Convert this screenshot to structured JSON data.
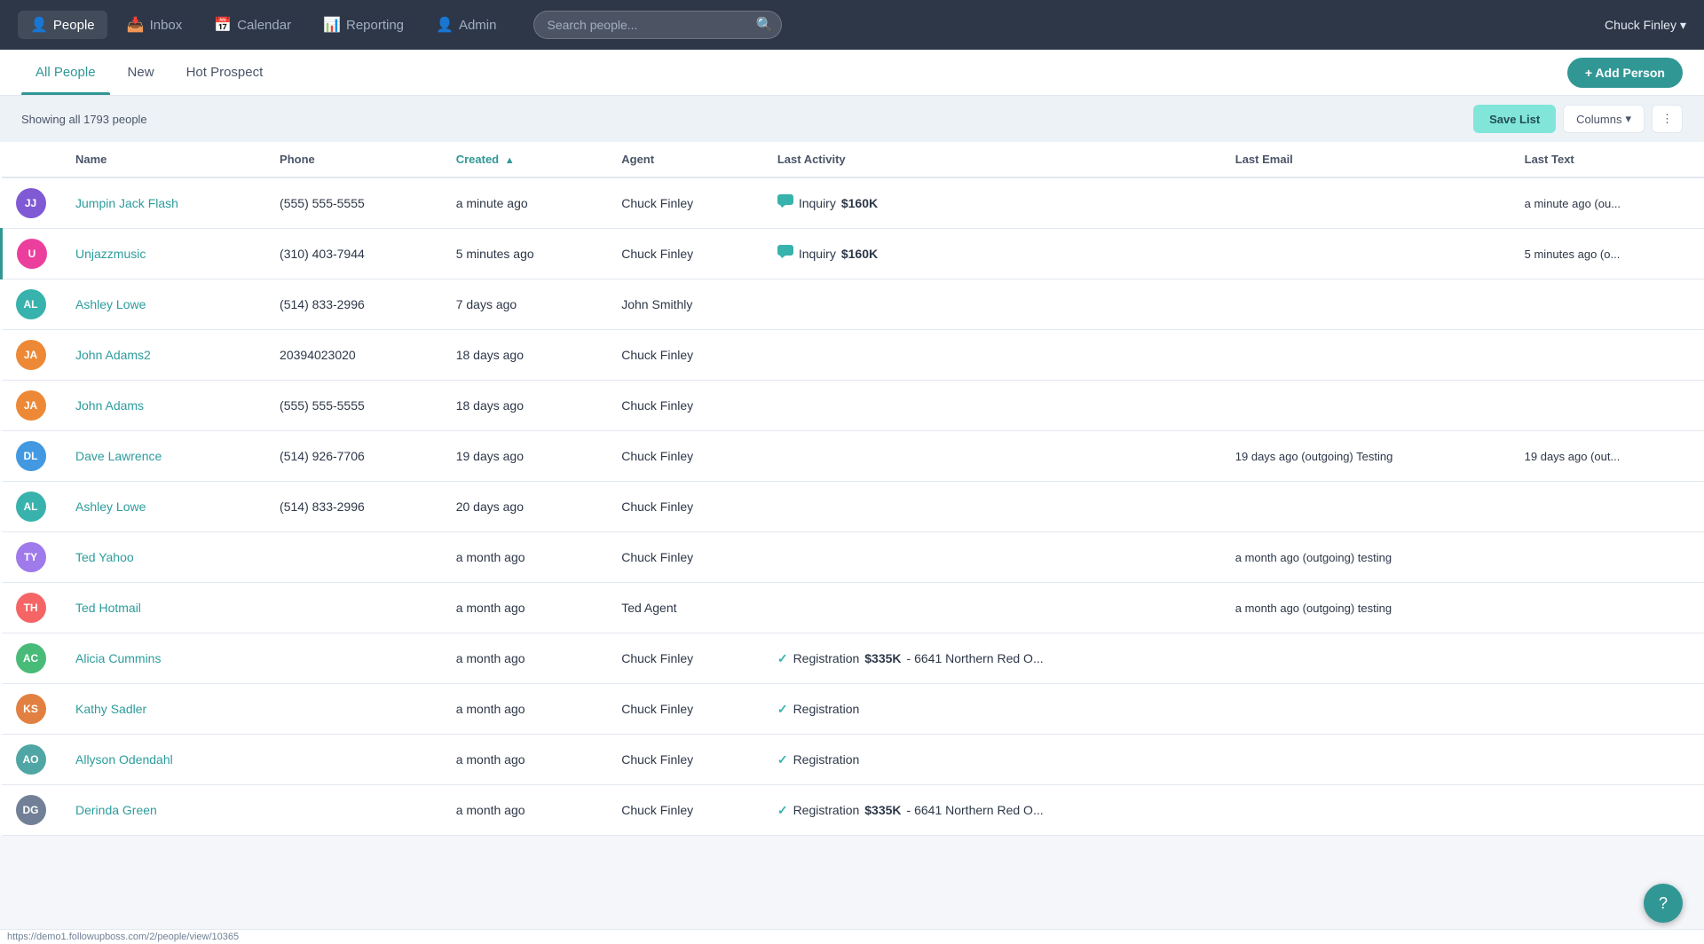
{
  "nav": {
    "brand": "People",
    "items": [
      {
        "id": "people",
        "label": "People",
        "icon": "👤",
        "active": true
      },
      {
        "id": "inbox",
        "label": "Inbox",
        "icon": "📥",
        "active": false
      },
      {
        "id": "calendar",
        "label": "Calendar",
        "icon": "📅",
        "active": false
      },
      {
        "id": "reporting",
        "label": "Reporting",
        "icon": "📊",
        "active": false
      },
      {
        "id": "admin",
        "label": "Admin",
        "icon": "👤",
        "active": false
      }
    ],
    "search_placeholder": "Search people...",
    "user": "Chuck Finley"
  },
  "tabs": [
    {
      "id": "all",
      "label": "All People",
      "active": true
    },
    {
      "id": "new",
      "label": "New",
      "active": false
    },
    {
      "id": "hot",
      "label": "Hot Prospect",
      "active": false
    }
  ],
  "add_button": "+ Add Person",
  "toolbar": {
    "showing": "Showing all 1793 people",
    "save_list": "Save List",
    "columns": "Columns",
    "filter_icon": "⋮"
  },
  "columns": [
    {
      "id": "name",
      "label": "Name",
      "sorted": false
    },
    {
      "id": "phone",
      "label": "Phone",
      "sorted": false
    },
    {
      "id": "created",
      "label": "Created",
      "sorted": true,
      "sort_dir": "▲"
    },
    {
      "id": "agent",
      "label": "Agent",
      "sorted": false
    },
    {
      "id": "last_activity",
      "label": "Last Activity",
      "sorted": false
    },
    {
      "id": "last_email",
      "label": "Last Email",
      "sorted": false
    },
    {
      "id": "last_text",
      "label": "Last Text",
      "sorted": false
    }
  ],
  "rows": [
    {
      "initials": "JJ",
      "bg": "#805ad5",
      "name": "Jumpin Jack Flash",
      "phone": "(555) 555-5555",
      "created": "a minute ago",
      "agent": "Chuck Finley",
      "last_activity_type": "chat",
      "last_activity": "Inquiry $160K",
      "last_activity_bold": "$160K",
      "last_email": "",
      "last_text": "a minute ago (ou...",
      "selected": false,
      "has_img": false
    },
    {
      "initials": "U",
      "bg": "#e91e8c",
      "name": "Unjazzmusic",
      "phone": "(310) 403-7944",
      "created": "5 minutes ago",
      "agent": "Chuck Finley",
      "last_activity_type": "chat",
      "last_activity": "Inquiry $160K",
      "last_activity_bold": "$160K",
      "last_email": "",
      "last_text": "5 minutes ago (o...",
      "selected": true,
      "has_img": true
    },
    {
      "initials": "AL",
      "bg": "#38b2ac",
      "name": "Ashley Lowe",
      "phone": "(514) 833-2996",
      "created": "7 days ago",
      "agent": "John Smithly",
      "last_activity_type": "",
      "last_activity": "",
      "last_email": "",
      "last_text": "",
      "selected": false,
      "has_img": false
    },
    {
      "initials": "JA",
      "bg": "#ed8936",
      "name": "John Adams2",
      "phone": "20394023020",
      "created": "18 days ago",
      "agent": "Chuck Finley",
      "last_activity_type": "",
      "last_activity": "",
      "last_email": "",
      "last_text": "",
      "selected": false,
      "has_img": false
    },
    {
      "initials": "JA",
      "bg": "#ed8936",
      "name": "John Adams",
      "phone": "(555) 555-5555",
      "created": "18 days ago",
      "agent": "Chuck Finley",
      "last_activity_type": "",
      "last_activity": "",
      "last_email": "",
      "last_text": "",
      "selected": false,
      "has_img": false
    },
    {
      "initials": "DL",
      "bg": "#4299e1",
      "name": "Dave Lawrence",
      "phone": "(514) 926-7706",
      "created": "19 days ago",
      "agent": "Chuck Finley",
      "last_activity_type": "",
      "last_activity": "",
      "last_email": "19 days ago (outgoing) Testing",
      "last_text": "19 days ago (out...",
      "selected": false,
      "has_img": false
    },
    {
      "initials": "AL",
      "bg": "#38b2ac",
      "name": "Ashley Lowe",
      "phone": "(514) 833-2996",
      "created": "20 days ago",
      "agent": "Chuck Finley",
      "last_activity_type": "",
      "last_activity": "",
      "last_email": "",
      "last_text": "",
      "selected": false,
      "has_img": false
    },
    {
      "initials": "TY",
      "bg": "#9f7aea",
      "name": "Ted Yahoo",
      "phone": "",
      "created": "a month ago",
      "agent": "Chuck Finley",
      "last_activity_type": "",
      "last_activity": "",
      "last_email": "a month ago (outgoing) testing",
      "last_text": "",
      "selected": false,
      "has_img": false
    },
    {
      "initials": "TH",
      "bg": "#f56565",
      "name": "Ted Hotmail",
      "phone": "",
      "created": "a month ago",
      "agent": "Ted Agent",
      "last_activity_type": "",
      "last_activity": "",
      "last_email": "a month ago (outgoing) testing",
      "last_text": "",
      "selected": false,
      "has_img": false
    },
    {
      "initials": "AC",
      "bg": "#48bb78",
      "name": "Alicia Cummins",
      "phone": "",
      "created": "a month ago",
      "agent": "Chuck Finley",
      "last_activity_type": "check",
      "last_activity": "Registration $335K - 6641 Northern Red O...",
      "last_activity_bold": "$335K",
      "last_email": "",
      "last_text": "",
      "selected": false,
      "has_img": false
    },
    {
      "initials": "KS",
      "bg": "#dd6b20",
      "name": "Kathy Sadler",
      "phone": "",
      "created": "a month ago",
      "agent": "Chuck Finley",
      "last_activity_type": "check",
      "last_activity": "Registration",
      "last_activity_bold": "",
      "last_email": "",
      "last_text": "",
      "selected": false,
      "has_img": true
    },
    {
      "initials": "AO",
      "bg": "#319795",
      "name": "Allyson Odendahl",
      "phone": "",
      "created": "a month ago",
      "agent": "Chuck Finley",
      "last_activity_type": "check",
      "last_activity": "Registration",
      "last_activity_bold": "",
      "last_email": "",
      "last_text": "",
      "selected": false,
      "has_img": true
    },
    {
      "initials": "DG",
      "bg": "#718096",
      "name": "Derinda Green",
      "phone": "",
      "created": "a month ago",
      "agent": "Chuck Finley",
      "last_activity_type": "check",
      "last_activity": "Registration $335K - 6641 Northern Red O...",
      "last_activity_bold": "$335K",
      "last_email": "",
      "last_text": "",
      "selected": false,
      "has_img": false
    }
  ],
  "statusbar": "https://demo1.followupboss.com/2/people/view/10365",
  "help_icon": "?"
}
